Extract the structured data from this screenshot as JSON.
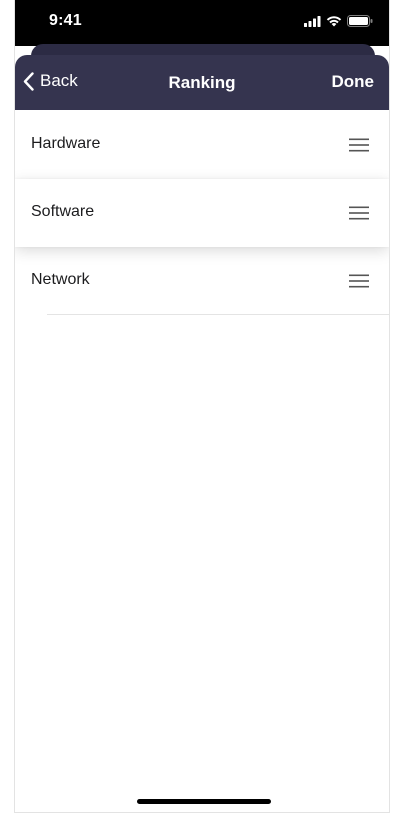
{
  "status_bar": {
    "time": "9:41",
    "icons": [
      "cellular-signal-icon",
      "wifi-icon",
      "battery-icon"
    ]
  },
  "nav": {
    "back_label": "Back",
    "title": "Ranking",
    "done_label": "Done"
  },
  "list": {
    "items": [
      {
        "label": "Hardware",
        "dragging": false
      },
      {
        "label": "Software",
        "dragging": true
      },
      {
        "label": "Network",
        "dragging": false
      }
    ]
  },
  "colors": {
    "nav_background": "#35344f",
    "sheet_peek": "#2c2b44",
    "status_bar": "#000000"
  }
}
